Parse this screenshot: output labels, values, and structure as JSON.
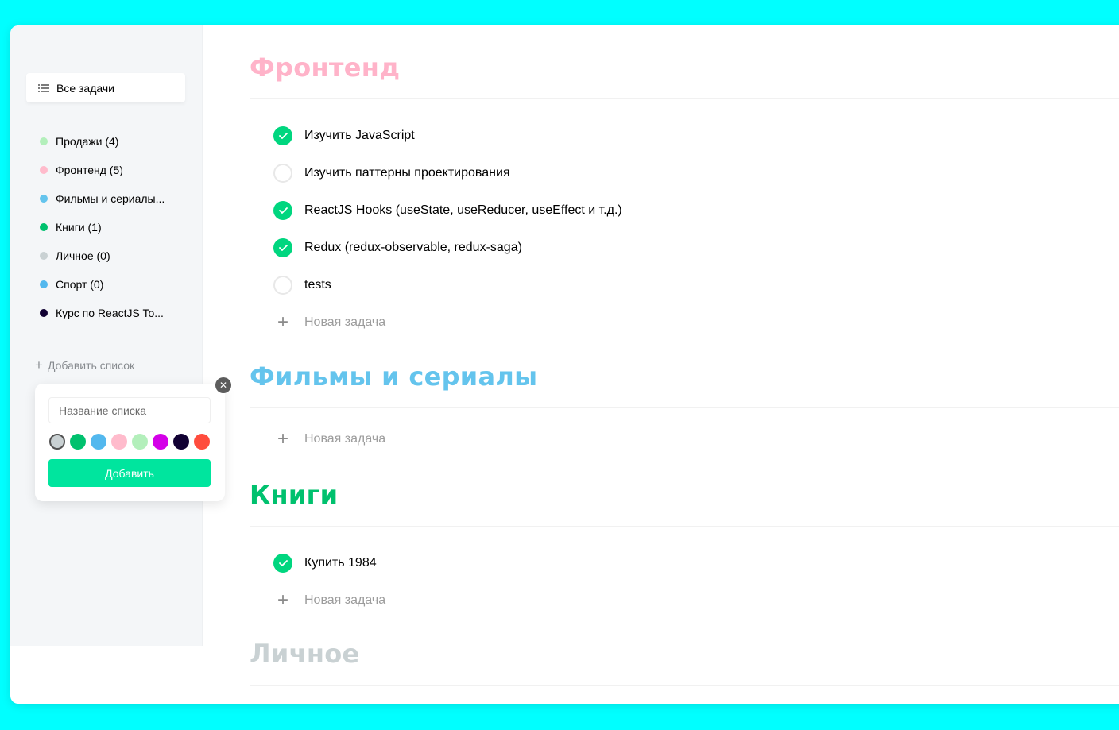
{
  "sidebar": {
    "all_tasks_label": "Все задачи",
    "lists": [
      {
        "label": "Продажи (4)",
        "color": "#b3efbb"
      },
      {
        "label": "Фронтенд (5)",
        "color": "#ffbbcc"
      },
      {
        "label": "Фильмы и сериалы...",
        "color": "#64c4ed"
      },
      {
        "label": "Книги (1)",
        "color": "#00c16e"
      },
      {
        "label": "Личное (0)",
        "color": "#c9d1d3"
      },
      {
        "label": "Спорт (0)",
        "color": "#53b8ee"
      },
      {
        "label": "Курс по ReactJS To...",
        "color": "#110133"
      }
    ],
    "add_list_label": "Добавить список"
  },
  "popup": {
    "placeholder": "Название списка",
    "colors": [
      "#c9d1d3",
      "#00c16e",
      "#53b8ee",
      "#ffbbcc",
      "#b3efbb",
      "#d400e8",
      "#110133",
      "#ff4c3d"
    ],
    "selected_color_index": 0,
    "add_button_label": "Добавить",
    "close_icon": "close-icon"
  },
  "sections": [
    {
      "title": "Фронтенд",
      "color": "#ffb3c9",
      "tasks": [
        {
          "text": "Изучить JavaScript",
          "done": true
        },
        {
          "text": "Изучить паттерны проектирования",
          "done": false
        },
        {
          "text": "ReactJS Hooks (useState, useReducer, useEffect и т.д.)",
          "done": true
        },
        {
          "text": "Redux (redux-observable, redux-saga)",
          "done": true
        },
        {
          "text": "tests",
          "done": false
        }
      ],
      "new_task_label": "Новая задача"
    },
    {
      "title": "Фильмы и сериалы",
      "color": "#64c4ed",
      "tasks": [],
      "new_task_label": "Новая задача"
    },
    {
      "title": "Книги",
      "color": "#00c16e",
      "tasks": [
        {
          "text": "Купить 1984",
          "done": true
        }
      ],
      "new_task_label": "Новая задача"
    },
    {
      "title": "Личное",
      "color": "#c9d1d3",
      "tasks": [],
      "new_task_label": ""
    }
  ]
}
